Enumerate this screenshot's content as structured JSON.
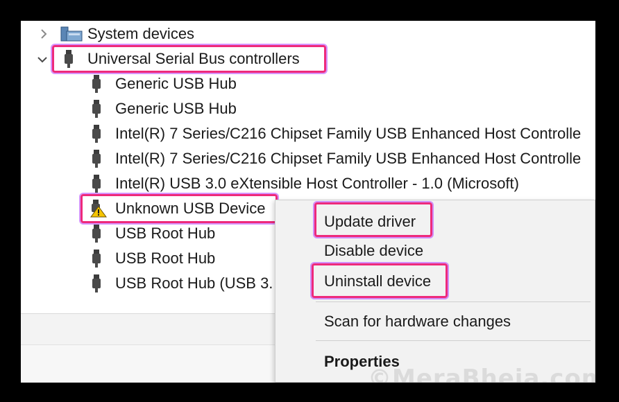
{
  "tree": {
    "system_devices": {
      "label": "System devices",
      "expanded": false
    },
    "usb_controllers": {
      "label": "Universal Serial Bus controllers",
      "expanded": true,
      "children": [
        {
          "label": "Generic USB Hub"
        },
        {
          "label": "Generic USB Hub"
        },
        {
          "label": "Intel(R) 7 Series/C216 Chipset Family USB Enhanced Host Controlle"
        },
        {
          "label": "Intel(R) 7 Series/C216 Chipset Family USB Enhanced Host Controlle"
        },
        {
          "label": "Intel(R) USB 3.0 eXtensible Host Controller - 1.0 (Microsoft)"
        },
        {
          "label": "Unknown USB Device",
          "warning": true
        },
        {
          "label": "USB Root Hub"
        },
        {
          "label": "USB Root Hub"
        },
        {
          "label": "USB Root Hub (USB 3."
        }
      ]
    }
  },
  "context_menu": {
    "items": [
      {
        "label": "Update driver"
      },
      {
        "label": "Disable device"
      },
      {
        "label": "Uninstall device"
      },
      {
        "label": "Scan for hardware changes"
      },
      {
        "label": "Properties",
        "bold": true
      }
    ]
  },
  "watermark": "©MeraBheja.com",
  "colors": {
    "highlight_border": "#ee2a7b",
    "highlight_glow": "#b43cff",
    "background": "#000000",
    "menu_bg": "#f2f2f2",
    "warning_yellow": "#f5c400"
  },
  "icons": {
    "collapsed": "chevron-right-icon",
    "expanded": "chevron-down-icon",
    "category": "system-devices-folder-icon",
    "usb": "usb-connector-icon",
    "warning": "warning-triangle-icon"
  }
}
